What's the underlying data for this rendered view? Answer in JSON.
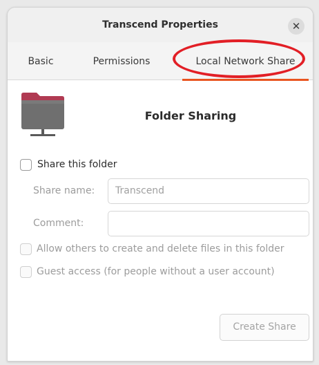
{
  "window": {
    "title": "Transcend Properties",
    "close_icon": "close-icon"
  },
  "tabs": [
    {
      "label": "Basic",
      "active": false
    },
    {
      "label": "Permissions",
      "active": false
    },
    {
      "label": "Local Network Share",
      "active": true
    }
  ],
  "colors": {
    "accent": "#e95420",
    "highlight_ring": "#e21f26",
    "folder_body": "#6f6f6f",
    "folder_tab": "#b03a52"
  },
  "sharing": {
    "icon": "network-folder-icon",
    "heading": "Folder Sharing",
    "share_checkbox": {
      "label": "Share this folder",
      "checked": false
    },
    "share_name": {
      "label": "Share name:",
      "value": "Transcend"
    },
    "comment": {
      "label": "Comment:",
      "value": ""
    },
    "allow_others": {
      "label": "Allow others to create and delete files in this folder",
      "checked": false,
      "enabled": false
    },
    "guest_access": {
      "label": "Guest access (for people without a user account)",
      "checked": false,
      "enabled": false
    },
    "create_button": "Create Share"
  }
}
